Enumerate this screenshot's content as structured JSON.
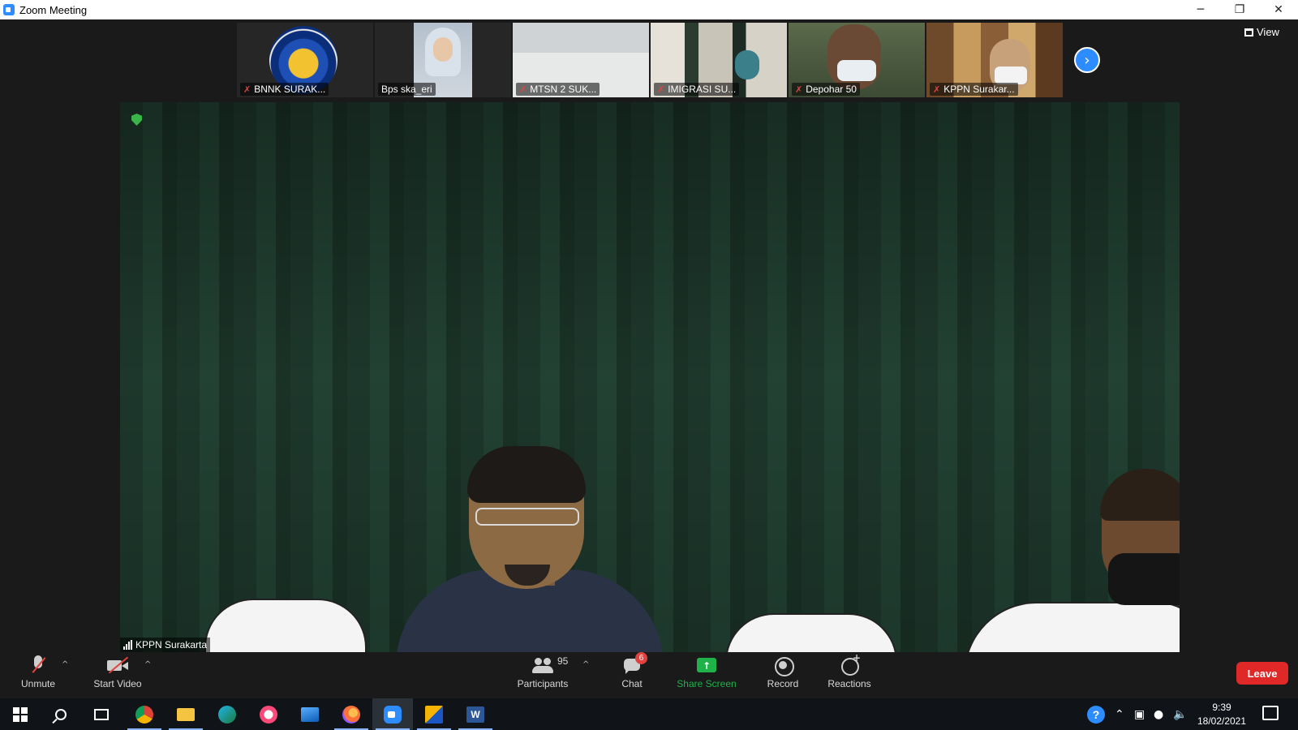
{
  "window": {
    "title": "Zoom Meeting",
    "minimize": "─",
    "restore": "❐",
    "close": "✕"
  },
  "gallery": {
    "participants": [
      {
        "name": "BNNK SURAK...",
        "muted": true
      },
      {
        "name": "Bps ska_eri",
        "muted": false
      },
      {
        "name": "MTSN 2 SUK...",
        "muted": true
      },
      {
        "name": "IMIGRASI SU...",
        "muted": true
      },
      {
        "name": "Depohar 50",
        "muted": true
      },
      {
        "name": "KPPN Surakar...",
        "muted": true
      }
    ],
    "next_icon": "›",
    "view_label": "View"
  },
  "main_video": {
    "speaker_name": "KPPN Surakarta"
  },
  "toolbar": {
    "unmute": "Unmute",
    "start_video": "Start Video",
    "participants": "Participants",
    "participants_count": "95",
    "chat": "Chat",
    "chat_badge": "6",
    "share_screen": "Share Screen",
    "record": "Record",
    "reactions": "Reactions",
    "leave": "Leave",
    "caret": "^"
  },
  "taskbar": {
    "time": "9:39",
    "date": "18/02/2021",
    "help": "?"
  },
  "colors": {
    "accent": "#2d8cff",
    "share_green": "#1fb24a",
    "leave_red": "#e02828",
    "mute_red": "#e0433f"
  }
}
